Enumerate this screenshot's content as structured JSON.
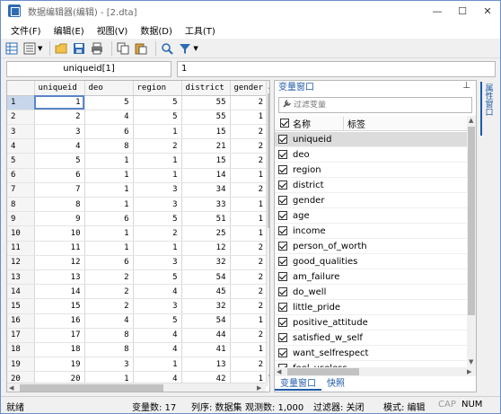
{
  "window": {
    "title": "数据编辑器(编辑) - [2.dta]",
    "minimize": "—",
    "maximize": "☐",
    "close": "✕"
  },
  "menu": [
    "文件(F)",
    "编辑(E)",
    "视图(V)",
    "数据(D)",
    "工具(T)"
  ],
  "toolbar": {
    "icons": [
      "grid-view-icon",
      "variables-icon",
      "open-folder-icon",
      "save-icon",
      "print-icon",
      "copy-icon",
      "paste-icon",
      "search-icon",
      "filter-icon"
    ]
  },
  "cellbar": {
    "name": "uniqueid[1]",
    "value": "1"
  },
  "grid": {
    "columns": [
      "uniqueid",
      "deo",
      "region",
      "district",
      "gender"
    ],
    "rows": [
      [
        "1",
        "1",
        "5",
        "5",
        "55",
        "2"
      ],
      [
        "2",
        "2",
        "4",
        "5",
        "55",
        "1"
      ],
      [
        "3",
        "3",
        "6",
        "1",
        "15",
        "2"
      ],
      [
        "4",
        "4",
        "8",
        "2",
        "21",
        "2"
      ],
      [
        "5",
        "5",
        "1",
        "1",
        "15",
        "2"
      ],
      [
        "6",
        "6",
        "1",
        "1",
        "14",
        "1"
      ],
      [
        "7",
        "7",
        "1",
        "3",
        "34",
        "2"
      ],
      [
        "8",
        "8",
        "1",
        "3",
        "33",
        "1"
      ],
      [
        "9",
        "9",
        "6",
        "5",
        "51",
        "1"
      ],
      [
        "10",
        "10",
        "1",
        "2",
        "25",
        "1"
      ],
      [
        "11",
        "11",
        "1",
        "1",
        "12",
        "2"
      ],
      [
        "12",
        "12",
        "6",
        "3",
        "32",
        "2"
      ],
      [
        "13",
        "13",
        "2",
        "5",
        "54",
        "2"
      ],
      [
        "14",
        "14",
        "2",
        "4",
        "45",
        "2"
      ],
      [
        "15",
        "15",
        "2",
        "3",
        "32",
        "2"
      ],
      [
        "16",
        "16",
        "4",
        "5",
        "54",
        "1"
      ],
      [
        "17",
        "17",
        "8",
        "4",
        "44",
        "2"
      ],
      [
        "18",
        "18",
        "8",
        "4",
        "41",
        "1"
      ],
      [
        "19",
        "19",
        "3",
        "1",
        "13",
        "2"
      ],
      [
        "20",
        "20",
        "1",
        "4",
        "42",
        "1"
      ]
    ]
  },
  "variables": {
    "title": "变量窗口",
    "pin": "⊥",
    "filter_placeholder": "过滤变量",
    "col_name": "名称",
    "col_label": "标签",
    "items": [
      "uniqueid",
      "deo",
      "region",
      "district",
      "gender",
      "age",
      "income",
      "person_of_worth",
      "good_qualities",
      "am_failure",
      "do_well",
      "little_pride",
      "positive_attitude",
      "satisfied_w_self",
      "want_selfrespect",
      "feel_useless"
    ],
    "tabs": [
      "变量窗口",
      "快照"
    ]
  },
  "side_tab": "属性窗口",
  "status": {
    "ready": "就绪",
    "var_count": "变量数: 17",
    "order": "列序: 数据集",
    "obs": "观测数: 1,000",
    "filter": "过滤器: 关闭",
    "mode": "模式: 编辑",
    "cap": "CAP",
    "num": "NUM"
  }
}
